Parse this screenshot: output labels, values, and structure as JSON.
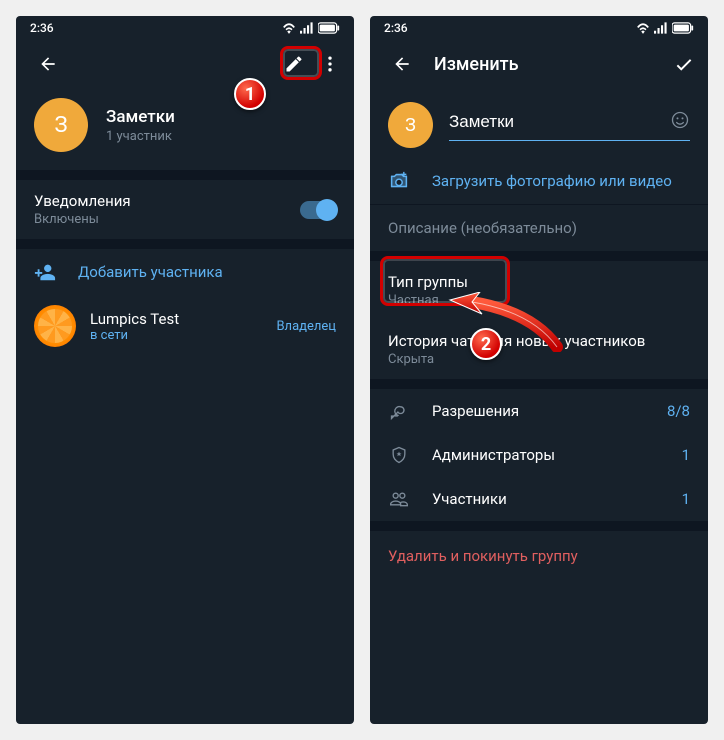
{
  "status": {
    "time": "2:36"
  },
  "left": {
    "profile": {
      "initial": "З",
      "name": "Заметки",
      "members": "1 участник"
    },
    "notifications": {
      "label": "Уведомления",
      "state": "Включены"
    },
    "add_member": "Добавить участника",
    "member": {
      "name": "Lumpics Test",
      "status": "в сети",
      "role": "Владелец"
    }
  },
  "right": {
    "title": "Изменить",
    "profile": {
      "initial": "З",
      "name": "Заметки"
    },
    "upload": "Загрузить фотографию или видео",
    "description_placeholder": "Описание (необязательно)",
    "group_type": {
      "label": "Тип группы",
      "value": "Частная"
    },
    "history": {
      "label": "История чата для новых участников",
      "value": "Скрыта"
    },
    "permissions": {
      "label": "Разрешения",
      "value": "8/8"
    },
    "admins": {
      "label": "Администраторы",
      "value": "1"
    },
    "members": {
      "label": "Участники",
      "value": "1"
    },
    "delete": "Удалить и покинуть группу"
  },
  "callouts": {
    "one": "1",
    "two": "2"
  }
}
